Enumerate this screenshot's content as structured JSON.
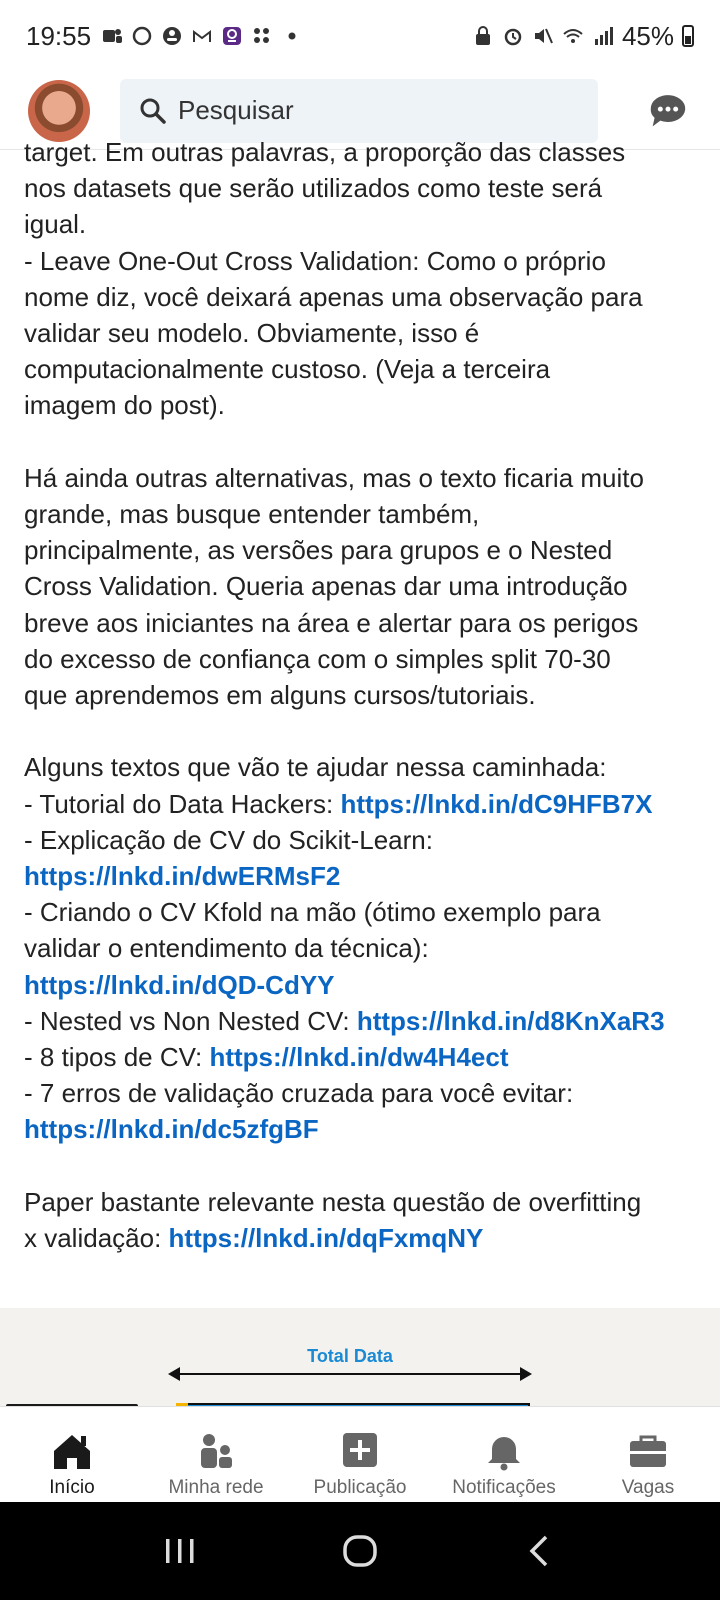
{
  "status_bar": {
    "time": "19:55",
    "battery": "45%",
    "left_icons": [
      "teams-icon",
      "threads-icon",
      "account-icon",
      "gmail-icon",
      "notification-app-icon",
      "grid-icon",
      "dot-icon"
    ],
    "right_icons": [
      "lock-icon",
      "alarm-icon",
      "mute-icon",
      "wifi-icon",
      "signal-icon",
      "battery-icon"
    ]
  },
  "header": {
    "search_placeholder": "Pesquisar",
    "avatar_icon": "profile-avatar",
    "messaging_icon": "message-icon"
  },
  "post": {
    "lines": [
      {
        "text": "target. Em outras palavras, a proporção das classes"
      },
      {
        "text": "nos datasets que serão utilizados como teste será"
      },
      {
        "text": "igual."
      },
      {
        "text": "- Leave One-Out Cross Validation: Como o próprio"
      },
      {
        "text": "nome diz, você deixará apenas uma observação para"
      },
      {
        "text": "validar seu modelo. Obviamente, isso é"
      },
      {
        "text": "computacionalmente custoso. (Veja a terceira"
      },
      {
        "text": "imagem do post)."
      },
      {
        "text": ""
      },
      {
        "text": "Há ainda outras alternativas, mas o texto ficaria muito"
      },
      {
        "text": "grande, mas busque entender também,"
      },
      {
        "text": "principalmente, as versões para grupos e o Nested"
      },
      {
        "text": "Cross Validation. Queria apenas dar uma introdução"
      },
      {
        "text": "breve aos iniciantes na área e alertar para os perigos"
      },
      {
        "text": "do excesso de confiança com o simples split 70-30"
      },
      {
        "text": "que aprendemos em alguns cursos/tutoriais."
      },
      {
        "text": ""
      },
      {
        "text": "Alguns textos que vão te ajudar nessa caminhada:"
      },
      {
        "text": "- Tutorial do Data Hackers: ",
        "link": "https://lnkd.in/dC9HFB7X"
      },
      {
        "text": "- Explicação de CV do Scikit-Learn:"
      },
      {
        "text": "",
        "link": "https://lnkd.in/dwERMsF2"
      },
      {
        "text": "- Criando o CV Kfold na mão (ótimo exemplo para"
      },
      {
        "text": "validar o entendimento da técnica):"
      },
      {
        "text": "",
        "link": "https://lnkd.in/dQD-CdYY"
      },
      {
        "text": "- Nested vs Non Nested CV: ",
        "link": "https://lnkd.in/d8KnXaR3"
      },
      {
        "text": "- 8 tipos de CV: ",
        "link": "https://lnkd.in/dw4H4ect"
      },
      {
        "text": "- 7 erros de validação cruzada para você evitar:"
      },
      {
        "text": "",
        "link": "https://lnkd.in/dc5zfgBF"
      },
      {
        "text": ""
      },
      {
        "text": "Paper bastante relevante nesta questão de overfitting"
      },
      {
        "text": "x validação: ",
        "link": "https://lnkd.in/dqFxmqNY"
      }
    ]
  },
  "image_preview": {
    "title": "Total Data"
  },
  "bottom_nav": {
    "items": [
      {
        "label": "Início",
        "icon": "home-icon",
        "active": true
      },
      {
        "label": "Minha rede",
        "icon": "network-icon",
        "active": false
      },
      {
        "label": "Publicação",
        "icon": "post-icon",
        "active": false
      },
      {
        "label": "Notificações",
        "icon": "bell-icon",
        "active": false
      },
      {
        "label": "Vagas",
        "icon": "briefcase-icon",
        "active": false
      }
    ]
  },
  "system_nav": [
    "recents-icon",
    "home-circle-icon",
    "back-icon"
  ],
  "colors": {
    "link": "#0a66c2",
    "search_bg": "#eef3f8",
    "diagram_accent": "#1a8ad4"
  }
}
